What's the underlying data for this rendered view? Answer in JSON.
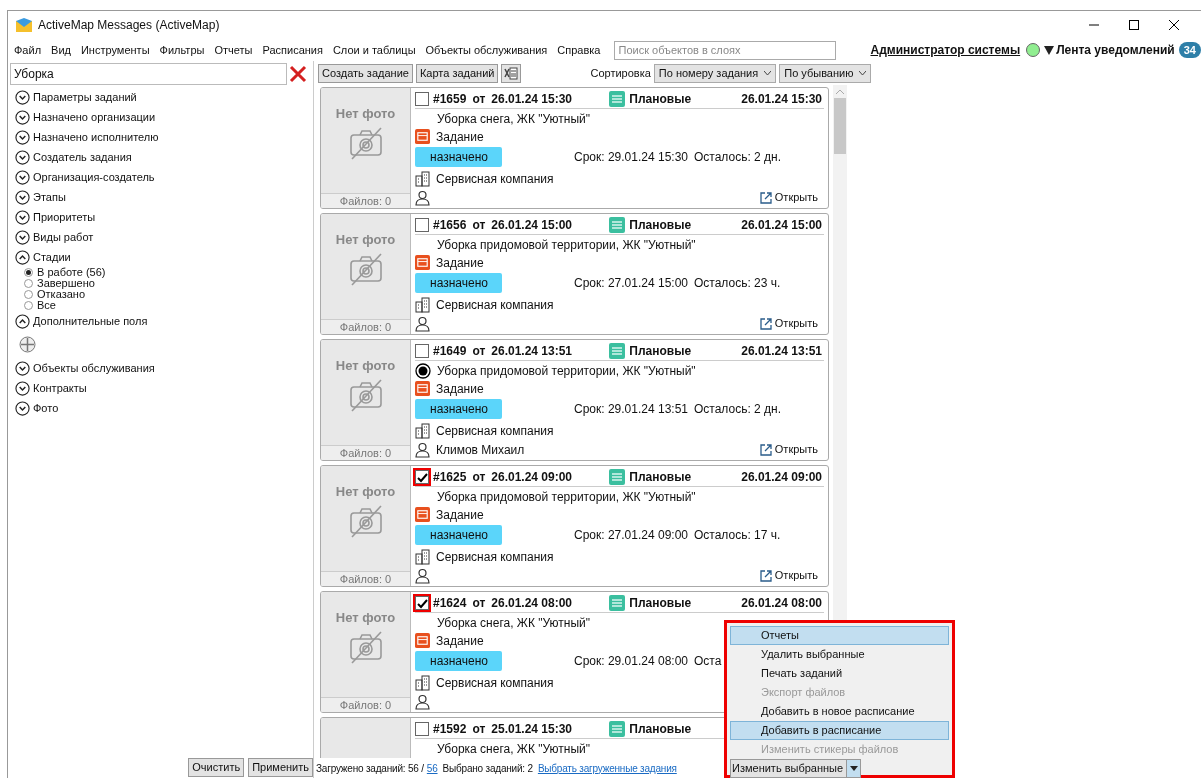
{
  "window": {
    "title": "ActiveMap Messages (ActiveMap)"
  },
  "menu": [
    "Файл",
    "Вид",
    "Инструменты",
    "Фильтры",
    "Отчеты",
    "Расписания",
    "Слои и таблицы",
    "Объекты обслуживания",
    "Справка"
  ],
  "layer_search": {
    "placeholder": "Поиск объектов в слоях"
  },
  "user": {
    "name": "Администратор системы",
    "online": true,
    "feed_label": "Лента уведомлений",
    "feed_count": "34"
  },
  "filter_search": {
    "value": "Уборка"
  },
  "filters": [
    {
      "label": "Параметры заданий",
      "expanded": false
    },
    {
      "label": "Назначено организации",
      "expanded": false
    },
    {
      "label": "Назначено исполнителю",
      "expanded": false
    },
    {
      "label": "Создатель задания",
      "expanded": false
    },
    {
      "label": "Организация-создатель",
      "expanded": false
    },
    {
      "label": "Этапы",
      "expanded": false
    },
    {
      "label": "Приоритеты",
      "expanded": false
    },
    {
      "label": "Виды работ",
      "expanded": false
    },
    {
      "label": "Стадии",
      "expanded": true,
      "options": [
        {
          "label": "В работе (56)",
          "selected": true
        },
        {
          "label": "Завершено",
          "selected": false
        },
        {
          "label": "Отказано",
          "selected": false
        },
        {
          "label": "Все",
          "selected": false
        }
      ]
    },
    {
      "label": "Дополнительные поля",
      "expanded": true,
      "add_button": true
    },
    {
      "label": "Объекты обслуживания",
      "expanded": false
    },
    {
      "label": "Контракты",
      "expanded": false
    },
    {
      "label": "Фото",
      "expanded": false
    }
  ],
  "toolbar": {
    "create": "Создать задание",
    "map": "Карта заданий",
    "sort_label": "Сортировка",
    "sort_by": "По номеру задания",
    "sort_order": "По убыванию"
  },
  "tasks": [
    {
      "number": "#1659",
      "from": "от",
      "created": "26.01.24 15:30",
      "category": "Плановые",
      "date": "26.01.24 15:30",
      "checked": false,
      "highlighted": false,
      "pinned": false,
      "title": "Уборка снега, ЖК \"Уютный\"",
      "type": "Задание",
      "status": "назначено",
      "due": "Срок: 29.01.24 15:30",
      "remaining": "Осталось: 2 дн.",
      "org": "Сервисная компания",
      "open": "Открыть",
      "no_photo": "Нет фото",
      "files": "Файлов: 0"
    },
    {
      "number": "#1656",
      "from": "от",
      "created": "26.01.24 15:00",
      "category": "Плановые",
      "date": "26.01.24 15:00",
      "checked": false,
      "highlighted": false,
      "pinned": false,
      "title": "Уборка придомовой территории, ЖК \"Уютный\"",
      "type": "Задание",
      "status": "назначено",
      "due": "Срок: 27.01.24 15:00",
      "remaining": "Осталось: 23 ч.",
      "org": "Сервисная компания",
      "open": "Открыть",
      "no_photo": "Нет фото",
      "files": "Файлов: 0"
    },
    {
      "number": "#1649",
      "from": "от",
      "created": "26.01.24 13:51",
      "category": "Плановые",
      "date": "26.01.24 13:51",
      "checked": false,
      "highlighted": false,
      "pinned": true,
      "title": "Уборка придомовой территории, ЖК \"Уютный\"",
      "type": "Задание",
      "status": "назначено",
      "due": "Срок: 29.01.24 13:51",
      "remaining": "Осталось: 2 дн.",
      "org": "Сервисная компания",
      "executor": "Климов Михаил",
      "open": "Открыть",
      "no_photo": "Нет фото",
      "files": "Файлов: 0"
    },
    {
      "number": "#1625",
      "from": "от",
      "created": "26.01.24 09:00",
      "category": "Плановые",
      "date": "26.01.24 09:00",
      "checked": true,
      "highlighted": true,
      "pinned": false,
      "title": "Уборка придомовой территории, ЖК \"Уютный\"",
      "type": "Задание",
      "status": "назначено",
      "due": "Срок: 27.01.24 09:00",
      "remaining": "Осталось: 17 ч.",
      "org": "Сервисная компания",
      "open": "Открыть",
      "no_photo": "Нет фото",
      "files": "Файлов: 0"
    },
    {
      "number": "#1624",
      "from": "от",
      "created": "26.01.24 08:00",
      "category": "Плановые",
      "date": "26.01.24 08:00",
      "checked": true,
      "highlighted": true,
      "pinned": false,
      "title": "Уборка снега, ЖК \"Уютный\"",
      "type": "Задание",
      "status": "назначено",
      "due": "Срок: 29.01.24 08:00",
      "remaining": "Оста",
      "org": "Сервисная компания",
      "no_photo": "Нет фото",
      "files": "Файлов: 0"
    },
    {
      "number": "#1592",
      "from": "от",
      "created": "25.01.24 15:30",
      "category": "Плановые",
      "checked": false,
      "highlighted": false,
      "pinned": false,
      "title": "Уборка снега, ЖК \"Уютный\""
    }
  ],
  "footer": {
    "clear": "Очистить",
    "apply": "Применить",
    "loaded": "Загружено заданий: 56 /",
    "loaded_link": "56",
    "selected": "Выбрано заданий: 2",
    "select_loaded": "Выбрать загруженные задания",
    "bulk": "Изменить выбранные"
  },
  "bulk_menu": {
    "highlighted": true,
    "items": [
      {
        "label": "Отчеты",
        "selected": true,
        "disabled": false
      },
      {
        "label": "Удалить выбранные",
        "selected": false,
        "disabled": false
      },
      {
        "label": "Печать заданий",
        "selected": false,
        "disabled": false
      },
      {
        "label": "Экспорт файлов",
        "selected": false,
        "disabled": true
      },
      {
        "label": "Добавить в новое расписание",
        "selected": false,
        "disabled": false
      },
      {
        "label": "Добавить в расписание",
        "selected": true,
        "disabled": false
      },
      {
        "label": "Изменить стикеры файлов",
        "selected": false,
        "disabled": true
      }
    ]
  }
}
